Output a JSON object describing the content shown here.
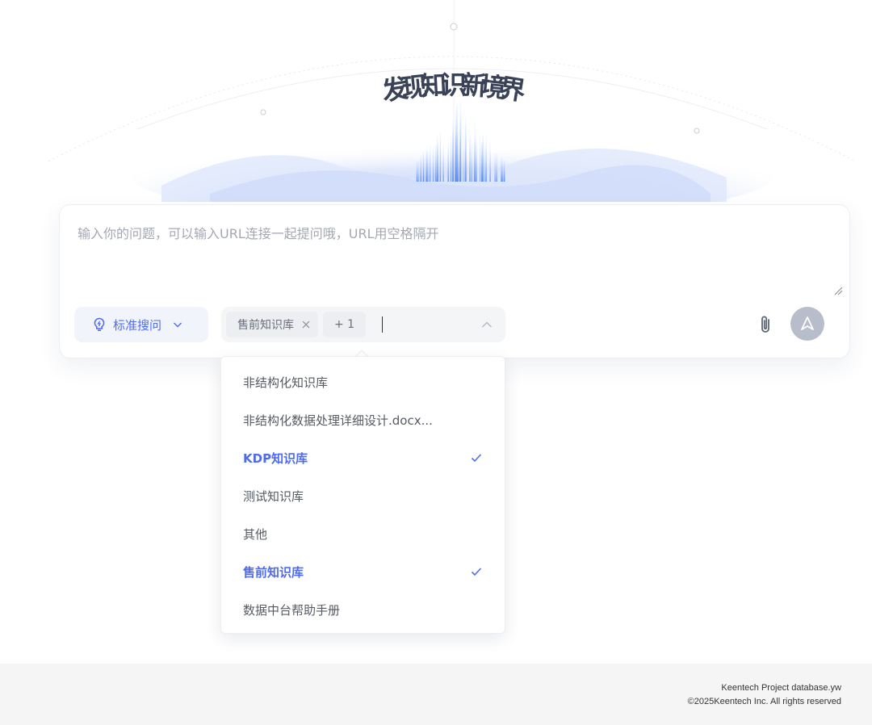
{
  "hero": {
    "title_chars": [
      "发",
      "现",
      "知",
      "识",
      "新",
      "境",
      "界"
    ]
  },
  "query": {
    "placeholder": "输入你的问题，可以输入URL连接一起提问哦，URL用空格隔开",
    "value": ""
  },
  "mode_select": {
    "label": "标准搜问",
    "icon": "bulb-icon"
  },
  "kb_select": {
    "selected_tag": "售前知识库",
    "more_count": "+ 1"
  },
  "dropdown": {
    "options": [
      {
        "label": "非结构化知识库",
        "selected": false
      },
      {
        "label": "非结构化数据处理详细设计.docx...",
        "selected": false
      },
      {
        "label": "KDP知识库",
        "selected": true
      },
      {
        "label": "测试知识库",
        "selected": false
      },
      {
        "label": "其他",
        "selected": false
      },
      {
        "label": "售前知识库",
        "selected": true
      },
      {
        "label": "数据中台帮助手册",
        "selected": false
      }
    ]
  },
  "footer": {
    "line1": "Keentech Project database.yw",
    "line2": "©2025Keentech Inc. All rights reserved"
  },
  "colors": {
    "accent": "#4f6bf0",
    "send_disabled": "#b7bdca",
    "footer_bg": "#f5f5f6"
  }
}
